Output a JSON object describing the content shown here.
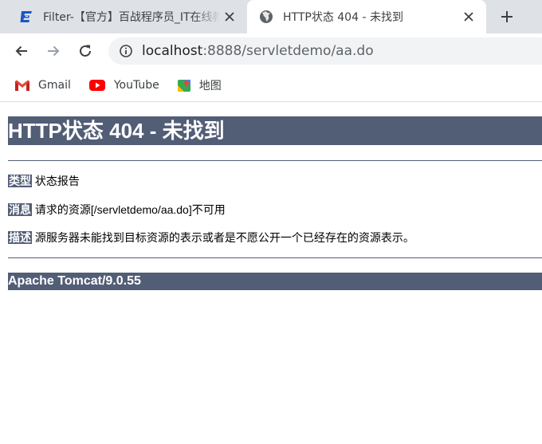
{
  "tabs": [
    {
      "title": "Filter-【官方】百战程序员_IT在线教育",
      "active": false,
      "favicon": "baizhan-logo-icon"
    },
    {
      "title": "HTTP状态 404 - 未找到",
      "active": true,
      "favicon": "globe-icon"
    }
  ],
  "toolbar": {
    "url_host": "localhost",
    "url_rest": ":8888/servletdemo/aa.do"
  },
  "bookmarks": [
    {
      "label": "Gmail",
      "icon": "gmail-icon"
    },
    {
      "label": "YouTube",
      "icon": "youtube-icon"
    },
    {
      "label": "地图",
      "icon": "maps-icon"
    }
  ],
  "error_page": {
    "heading": "HTTP状态 404 - 未找到",
    "rows": [
      {
        "label": "类型",
        "text": "状态报告"
      },
      {
        "label": "消息",
        "text": "请求的资源[/servletdemo/aa.do]不可用"
      },
      {
        "label": "描述",
        "text": "源服务器未能找到目标资源的表示或者是不愿公开一个已经存在的资源表示。"
      }
    ],
    "footer": "Apache Tomcat/9.0.55"
  },
  "colors": {
    "tomcat_bar": "#525d76",
    "tabstrip": "#dee1e6",
    "omnibox": "#f1f3f4"
  }
}
